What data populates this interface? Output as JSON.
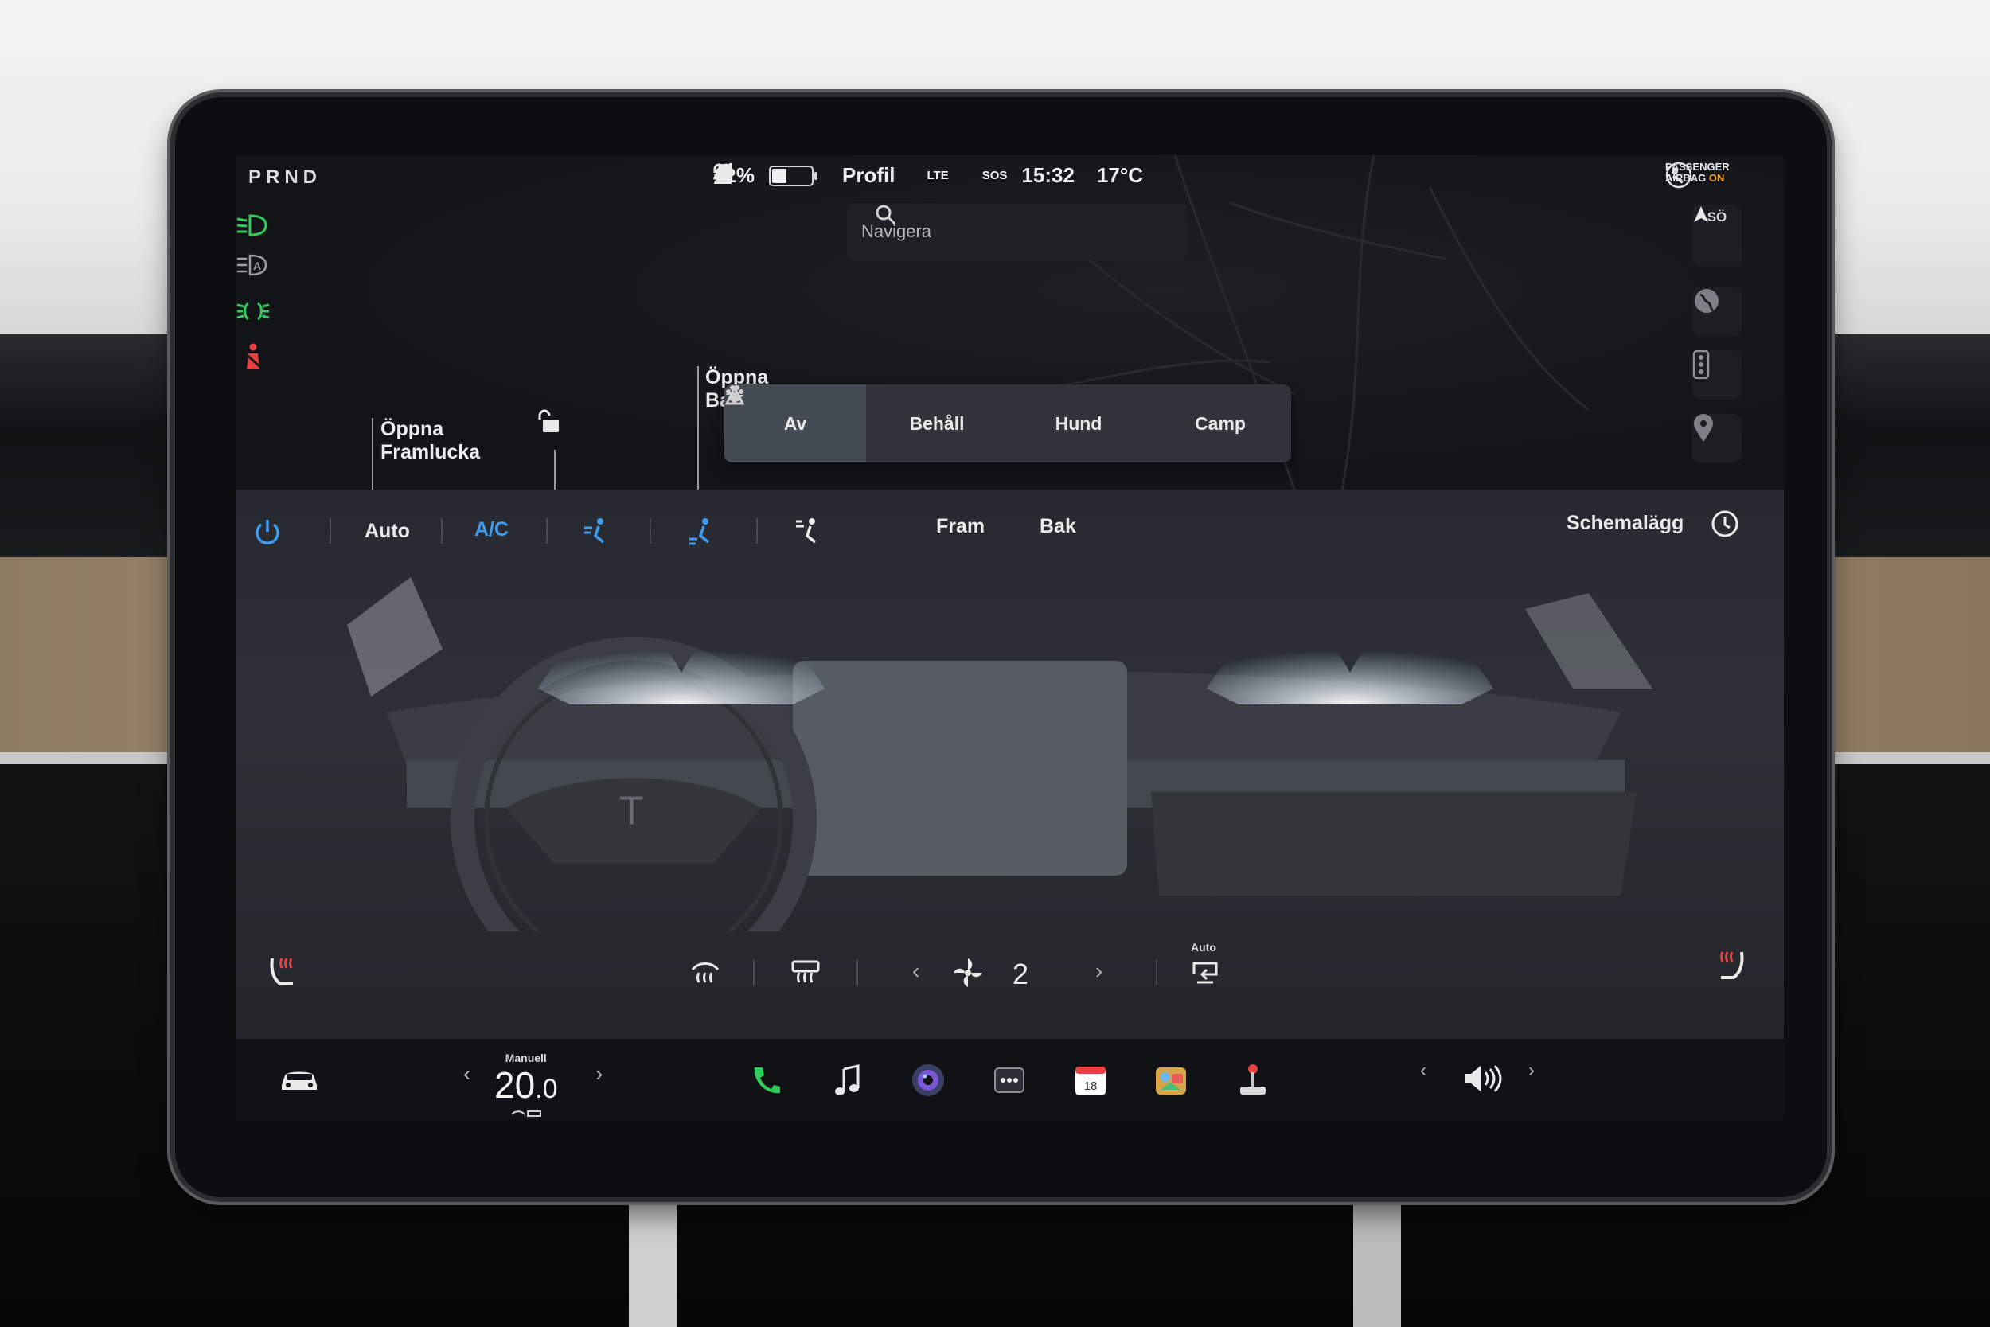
{
  "status_bar": {
    "gear": "PRND",
    "battery_percent": "41%",
    "battery_level": 0.41,
    "profile_label": "Profil",
    "network": "LTE",
    "sos": "SOS",
    "time": "15:32",
    "weather_temp": "17°C",
    "airbag_line1": "PASSENGER",
    "airbag_line2": "AIRBAG",
    "airbag_state": "ON"
  },
  "map": {
    "search_placeholder": "Navigera",
    "compass_heading": "SÖ",
    "door_front_label_line1": "Öppna",
    "door_front_label_line2": "Framlucka",
    "door_rear_label_line1": "Öppna",
    "door_rear_label_line2": "Ba"
  },
  "keep_mode": {
    "options": [
      {
        "label": "Av",
        "icon": "none",
        "selected": true
      },
      {
        "label": "Behåll",
        "icon": "fan-keep-icon",
        "selected": false
      },
      {
        "label": "Hund",
        "icon": "paw-icon",
        "selected": false
      },
      {
        "label": "Camp",
        "icon": "tent-icon",
        "selected": false
      }
    ]
  },
  "climate": {
    "auto_label": "Auto",
    "ac_label": "A/C",
    "front_label": "Fram",
    "rear_label": "Bak",
    "schedule_label": "Schemalägg",
    "fan_speed": "2",
    "recirc_mode": "Auto"
  },
  "dock": {
    "temp_mode": "Manuell",
    "temp_whole": "20",
    "temp_decimal": ".0",
    "apps": [
      "phone-icon",
      "music-icon",
      "camera-icon",
      "more-icon",
      "calendar-icon",
      "toybox-icon",
      "joystick-icon"
    ],
    "calendar_day": "18"
  },
  "colors": {
    "accent_blue": "#3d9bf0",
    "telltale_green": "#2ecc5a",
    "telltale_red": "#e84040",
    "airbag_on": "#f0a030"
  }
}
